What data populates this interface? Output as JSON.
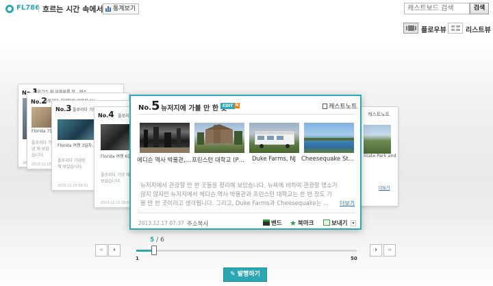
{
  "header": {
    "blog_id": "FL786",
    "title": "흐르는 시간 속에서",
    "stats_label": "통계보기",
    "search_placeholder": "캐스트보드 검색",
    "search_button": "검색"
  },
  "view_toggle": {
    "flow_label": "플로우뷰",
    "list_label": "리스트뷰",
    "selected": "flow"
  },
  "colors": {
    "accent": "#2aa7b3",
    "new_badge": "#f37b1d",
    "link": "#2a6fb0"
  },
  "back_cards": [
    {
      "no_prefix": "No.",
      "no": "1",
      "title": "테이크스 와 이블루를 맛 ..캐스..",
      "caption": "Florida 기념품 캐..",
      "text": "플로리다 기념 해주어 보았습니다.",
      "date": "2013.12.15"
    },
    {
      "no_prefix": "No.",
      "no": "2",
      "title": "플로리다 기념팅의 이야기 (1)",
      "caption": "Florida 7월의..",
      "text": "플로리다 기념 해 보았습니다.",
      "date": "2013.12.15 09:52"
    },
    {
      "no_prefix": "No.",
      "no": "3",
      "title": "플로리다 기념팅의 이야..",
      "caption": "Florida 여행 3일차..",
      "text": "플로리다 기념팅 해 보았습니다.",
      "date": "2013.12.15 09:52"
    },
    {
      "no_prefix": "No.",
      "no": "4",
      "title": "플로리다",
      "caption": "Florida 여행 6일..",
      "text": "플로리다 기념 해 보았습니다.",
      "date": "2013.12.15 09:52"
    }
  ],
  "right_card": {
    "castnote_label": "캐스트노트",
    "caption": "State Park and Ro...",
    "more_label": "더보기"
  },
  "featured": {
    "no_prefix": "No.",
    "no": "5",
    "title": "뉴저지에 가볼 만 한 곳",
    "edit_badge": "EDIT",
    "new_badge": "N",
    "castnote_label": "캐스트노트",
    "photos": [
      {
        "caption": "에디슨 역사 박물관, NJ",
        "icon": "museum-photo"
      },
      {
        "caption": "프린스턴 대학교 (Pri...",
        "icon": "university-photo"
      },
      {
        "caption": "Duke Farms, NJ",
        "icon": "tram-photo"
      },
      {
        "caption": "Cheesequake State...",
        "icon": "lake-photo"
      }
    ],
    "body": "뉴저지에서 관광할 만 한 곳들을 정리해 보았습니다. 뉴욕에 비하여 관광할 명소가 많지 않지만 뉴저지에서 에디슨 역사 박물관과 프린스턴 대학교는 한 번 정도 가 볼 만 한 곳이라고 생각됩니다. 그리고, Duke Farms과 Cheesequake는 ...",
    "more_label": "더보기",
    "date": "2013.12.17 07:37",
    "copy_label": "주소복사",
    "band_label": "밴드",
    "bookmark_label": "북마크",
    "send_label": "보내기"
  },
  "pager": {
    "current": "5",
    "separator": "/",
    "total": "6",
    "min": "1",
    "max": "50",
    "position_fraction": 0.08,
    "first_label": "«",
    "prev_label": "‹",
    "next_label": "›",
    "last_label": "»"
  },
  "publish_label": "발행하기"
}
